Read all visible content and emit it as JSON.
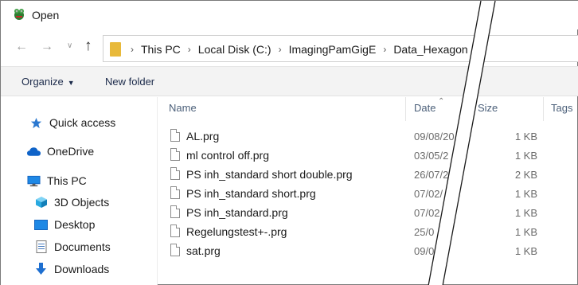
{
  "window": {
    "title": "Open",
    "app_icon": "app-icon"
  },
  "toolbar": {
    "back_icon": "arrow-left-icon",
    "forward_icon": "arrow-right-icon",
    "recent_icon": "chevron-down-icon",
    "up_icon": "arrow-up-icon",
    "breadcrumb": [
      "This PC",
      "Local Disk (C:)",
      "ImagingPamGigE",
      "Data_Hexagon"
    ]
  },
  "commands": {
    "organize_label": "Organize",
    "new_folder_label": "New folder"
  },
  "nav_pane": {
    "items": [
      {
        "label": "Quick access",
        "icon": "star-icon"
      },
      {
        "label": "OneDrive",
        "icon": "cloud-icon"
      },
      {
        "label": "This PC",
        "icon": "monitor-icon"
      },
      {
        "label": "3D Objects",
        "icon": "cube-icon"
      },
      {
        "label": "Desktop",
        "icon": "desktop-icon"
      },
      {
        "label": "Documents",
        "icon": "document-icon"
      },
      {
        "label": "Downloads",
        "icon": "download-icon"
      }
    ]
  },
  "file_list": {
    "columns": [
      "Name",
      "Date",
      "Size",
      "Tags"
    ],
    "rows": [
      {
        "name": "AL.prg",
        "date": "09/08/20",
        "size": "1 KB"
      },
      {
        "name": "ml control off.prg",
        "date": "03/05/2",
        "size": "1 KB"
      },
      {
        "name": "PS inh_standard short double.prg",
        "date": "26/07/2",
        "size": "2 KB"
      },
      {
        "name": "PS inh_standard short.prg",
        "date": "07/02/",
        "size": "1 KB"
      },
      {
        "name": "PS inh_standard.prg",
        "date": "07/02",
        "size": "1 KB"
      },
      {
        "name": "Regelungstest+-.prg",
        "date": "25/0",
        "size": "1 KB"
      },
      {
        "name": "sat.prg",
        "date": "09/0",
        "size": "1 KB"
      }
    ]
  },
  "colors": {
    "accent": "#0067c0",
    "folder": "#e8b93a",
    "command_bar": "#f3f3f3"
  }
}
